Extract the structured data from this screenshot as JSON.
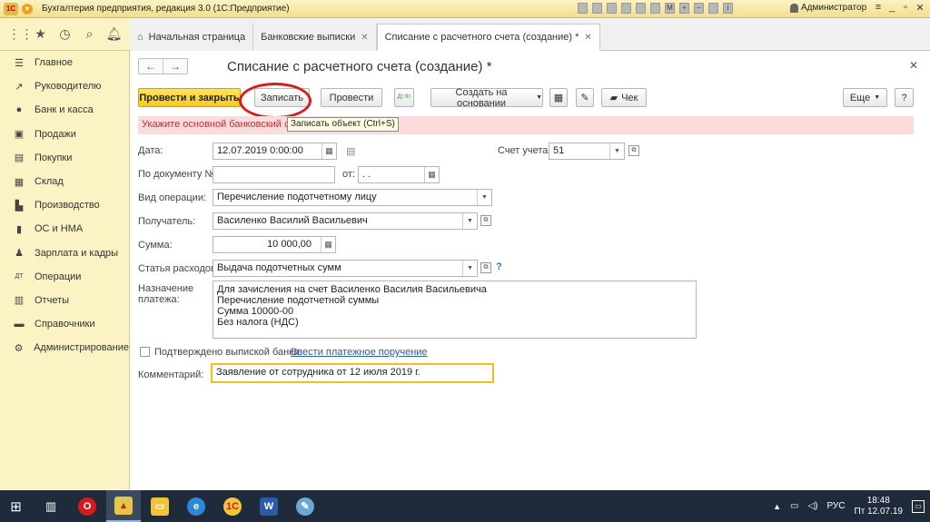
{
  "window": {
    "title": "Бухгалтерия предприятия, редакция 3.0  (1С:Предприятие)",
    "logo_text": "1С",
    "user": "Администратор"
  },
  "tabs": [
    {
      "label": "Начальная страница"
    },
    {
      "label": "Банковские выписки"
    },
    {
      "label": "Списание с расчетного счета (создание) *"
    }
  ],
  "sidebar": {
    "items": [
      {
        "label": "Главное",
        "icon": "list-icon"
      },
      {
        "label": "Руководителю",
        "icon": "trend-icon"
      },
      {
        "label": "Банк и касса",
        "icon": "coin-icon"
      },
      {
        "label": "Продажи",
        "icon": "cart-icon"
      },
      {
        "label": "Покупки",
        "icon": "basket-icon"
      },
      {
        "label": "Склад",
        "icon": "warehouse-icon"
      },
      {
        "label": "Производство",
        "icon": "factory-icon"
      },
      {
        "label": "ОС и НМА",
        "icon": "assets-icon"
      },
      {
        "label": "Зарплата и кадры",
        "icon": "person-icon"
      },
      {
        "label": "Операции",
        "icon": "dt-kt-icon"
      },
      {
        "label": "Отчеты",
        "icon": "report-icon"
      },
      {
        "label": "Справочники",
        "icon": "book-icon"
      },
      {
        "label": "Администрирование",
        "icon": "gear-icon"
      }
    ]
  },
  "form": {
    "title": "Списание с расчетного счета (создание) *",
    "buttons": {
      "post_close": "Провести и закрыть",
      "save": "Записать",
      "post": "Провести",
      "dt_kt": "Дт Кт",
      "create_based": "Создать на основании",
      "check": "Чек",
      "more": "Еще",
      "help": "?"
    },
    "warning": "Укажите основной банковский счет",
    "tooltip": "Записать объект (Ctrl+S)",
    "labels": {
      "date": "Дата:",
      "doc_no": "По документу №:",
      "from": "от:",
      "operation": "Вид операции:",
      "recipient": "Получатель:",
      "amount": "Сумма:",
      "expense": "Статья расходов:",
      "purpose": "Назначение платежа:",
      "account": "Счет учета:",
      "confirmed": "Подтверждено выпиской банка:",
      "comment": "Комментарий:"
    },
    "values": {
      "date": "12.07.2019  0:00:00",
      "doc_no": "",
      "doc_date": " .  .",
      "operation": "Перечисление подотчетному лицу",
      "recipient": "Василенко Василий Васильевич",
      "amount": "10 000,00",
      "expense": "Выдача подотчетных сумм",
      "purpose": "Для зачисления на счет Василенко Василия Васильевича\nПеречисление подотчетной суммы\nСумма 10000-00\nБез налога (НДС)",
      "account": "51",
      "comment": "Заявление от сотрудника от 12 июля 2019 г."
    },
    "link_payment_order": "Ввести платежное поручение"
  },
  "taskbar": {
    "lang": "РУС",
    "time": "18:48",
    "date": "Пт 12.07.19"
  }
}
